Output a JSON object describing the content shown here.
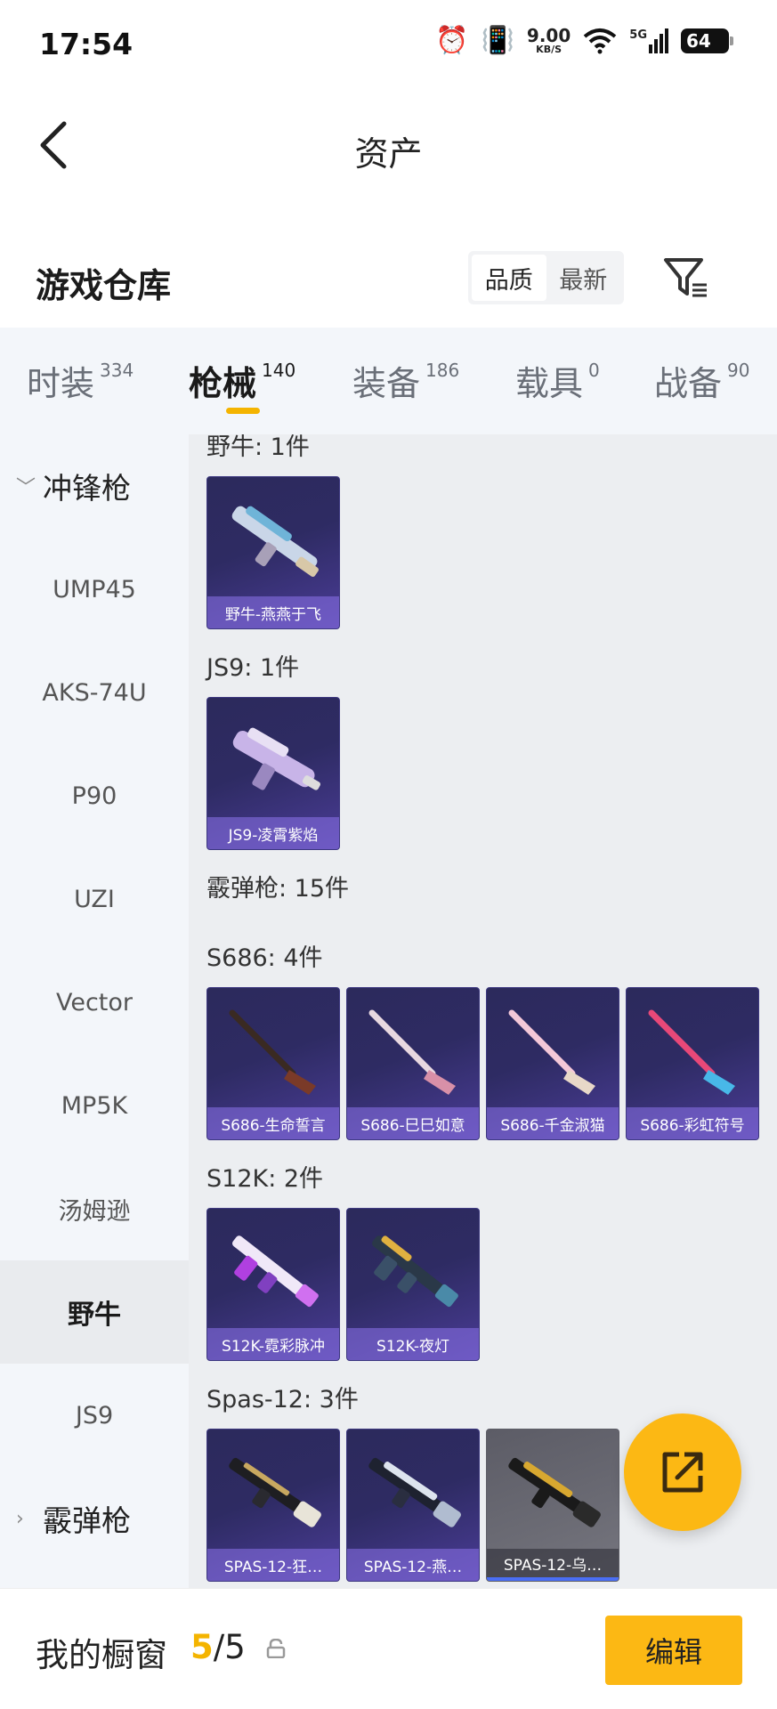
{
  "status_bar": {
    "time": "17:54",
    "net_speed": "9.00",
    "net_unit": "KB/S",
    "signal": "5G",
    "battery": "64"
  },
  "header": {
    "title": "资产"
  },
  "section": {
    "title": "游戏仓库",
    "sort_options": [
      "品质",
      "最新"
    ],
    "active_sort": "品质"
  },
  "tabs": [
    {
      "label": "时装",
      "count": "334"
    },
    {
      "label": "枪械",
      "count": "140",
      "active": true
    },
    {
      "label": "装备",
      "count": "186"
    },
    {
      "label": "载具",
      "count": "0"
    },
    {
      "label": "战备",
      "count": "90"
    }
  ],
  "sidebar": {
    "group1": "冲锋枪",
    "items": [
      "UMP45",
      "AKS-74U",
      "P90",
      "UZI",
      "Vector",
      "MP5K",
      "汤姆逊",
      "野牛",
      "JS9"
    ],
    "active_item": "野牛",
    "group2": "霰弹枪"
  },
  "content": {
    "groups": [
      {
        "label": "野牛: 1件",
        "items": [
          "野牛-燕燕于飞"
        ]
      },
      {
        "label": "JS9: 1件",
        "items": [
          "JS9-凌霄紫焰"
        ]
      },
      {
        "label": "霰弹枪: 15件",
        "items": []
      },
      {
        "label": "S686: 4件",
        "items": [
          "S686-生命誓言",
          "S686-巳巳如意",
          "S686-千金淑猫",
          "S686-彩虹符号"
        ]
      },
      {
        "label": "S12K: 2件",
        "items": [
          "S12K-霓彩脉冲",
          "S12K-夜灯"
        ]
      },
      {
        "label": "Spas-12: 3件",
        "items": [
          "SPAS-12-狂…",
          "SPAS-12-燕…",
          "SPAS-12-乌…"
        ]
      }
    ]
  },
  "bottom": {
    "showcase_label": "我的橱窗",
    "showcase_used": "5",
    "showcase_total": "/5",
    "edit_label": "编辑"
  },
  "colors": {
    "accent": "#fcb814",
    "card": "#2e2b63",
    "card_label": "#8c73eb"
  }
}
